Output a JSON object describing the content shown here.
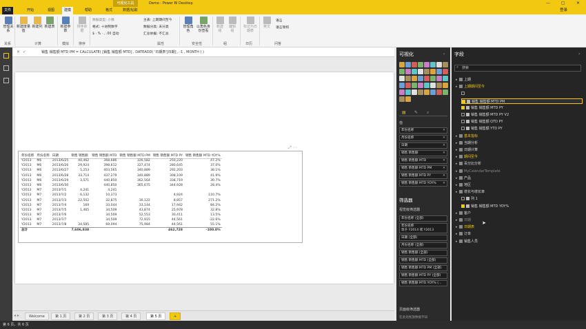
{
  "window": {
    "context_tab": "可视化工具",
    "title": "Demo - Power BI Desktop"
  },
  "tabs": [
    "文件",
    "开始",
    "视图",
    "建模",
    "帮助",
    "格式",
    "数据/钻取"
  ],
  "login": "登录",
  "ribbon": {
    "buttons": [
      "管理关系",
      "新建度量值",
      "新建列",
      "新建表",
      "新建参数",
      "排序依据",
      "管理角色",
      "以角色身份查看",
      "新建组",
      "编辑组",
      "标记为日期表",
      "英文"
    ],
    "groups": [
      "关系",
      "计算",
      "模拟",
      "排序",
      "属性",
      "安全性",
      "组",
      "日历",
      "问答"
    ],
    "fmt": [
      "数据类型: 小数",
      "格式: 十进制数字",
      "$ · % · ,  .00  自动"
    ],
    "props": [
      "主表: 上期期间至今",
      "数据分类: 未分类",
      "汇总依据: 不汇总"
    ],
    "lang": [
      "语言",
      "语言架构"
    ]
  },
  "formula": {
    "text": "销售 销售额 MTD PM = CALCULATE( [销售 销售额 MTD] , DATEADD( '日期表'[日期] , -1 , MONTH ) )"
  },
  "table": {
    "headers": [
      "年份名称",
      "月份名称",
      "日期",
      "销售 销售额",
      "销售 销售额 MTD",
      "销售 销售额 MTD PM",
      "销售 销售额 MTD PY",
      "销售 销售额 MTD YOY%"
    ],
    "rows": [
      [
        "Y2013",
        "M6",
        "2013/6/25",
        "40,462",
        "368,686",
        "326,582",
        "250,220",
        "47.2%"
      ],
      [
        "Y2013",
        "M6",
        "2013/6/26",
        "29,924",
        "398,612",
        "327,474",
        "280,645",
        "37.0%"
      ],
      [
        "Y2013",
        "M6",
        "2013/6/27",
        "5,253",
        "403,565",
        "340,889",
        "292,203",
        "38.1%"
      ],
      [
        "Y2013",
        "M6",
        "2013/6/28",
        "33,714",
        "437,279",
        "340,889",
        "308,109",
        "41.9%"
      ],
      [
        "Y2013",
        "M6",
        "2013/6/29",
        "3,571",
        "440,850",
        "362,564",
        "338,719",
        "30.7%"
      ],
      [
        "Y2013",
        "M6",
        "2013/6/30",
        "",
        "440,850",
        "365,675",
        "344,928",
        "28.4%"
      ],
      [
        "Y2013",
        "M7",
        "2013/7/1",
        "4,241",
        "4,241",
        "",
        "",
        ""
      ],
      [
        "Y2013",
        "M7",
        "2013/7/2",
        "6,132",
        "10,373",
        "",
        "4,924",
        "110.7%"
      ],
      [
        "Y2013",
        "M7",
        "2013/7/3",
        "22,502",
        "32,875",
        "16,122",
        "8,857",
        "271.2%"
      ],
      [
        "Y2013",
        "M7",
        "2013/7/4",
        "169",
        "33,044",
        "33,144",
        "17,942",
        "84.2%"
      ],
      [
        "Y2013",
        "M7",
        "2013/7/5",
        "1,465",
        "34,509",
        "43,874",
        "25,978",
        "32.8%"
      ],
      [
        "Y2013",
        "M7",
        "2013/7/6",
        "",
        "34,509",
        "52,553",
        "30,411",
        "13.5%"
      ],
      [
        "Y2013",
        "M7",
        "2013/7/7",
        "",
        "34,509",
        "72,915",
        "44,561",
        "-22.6%"
      ],
      [
        "Y2013",
        "M7",
        "2013/7/8",
        "34,585",
        "69,094",
        "75,984",
        "44,561",
        "55.1%"
      ]
    ],
    "total": [
      "总计",
      "",
      "",
      "7,606,838",
      "",
      "",
      "462,728",
      "-100.0%"
    ]
  },
  "pages": [
    "Welcome",
    "第 1 页",
    "第 2 页",
    "第 3 页",
    "第 4 页",
    "第 5 页",
    "+"
  ],
  "status": "第 6 页，共 6 页",
  "viz": {
    "title": "可视化",
    "values_label": "值",
    "wells": [
      "年份名称",
      "月份名称",
      "日期",
      "销售 销售额",
      "销售 销售额 MTD",
      "销售 销售额 MTD PM",
      "销售 销售额 MTD PY",
      "销售 销售额 MTD YOY%"
    ],
    "filters_title": "筛选器",
    "visual_filters_label": "视觉级筛选器",
    "filters": [
      "年份名称 (全部)",
      "年份名称\n等于 Y2014 或 Y2013",
      "日期 (全部)",
      "月份名称 (全部)",
      "销售 销售额 (全部)",
      "销售 销售额 MTD (全部)",
      "销售 销售额 MTD PM (全部)",
      "销售 销售额 MTD PY (全部)",
      "销售 销售额 MTD YOY% (..."
    ],
    "page_filters_label": "页面级筛选器",
    "drop_text": "在此处拖放数据字段"
  },
  "fields": {
    "title": "字段",
    "search_placeholder": "搜索",
    "items": [
      {
        "text": "上期",
        "type": "folder"
      },
      {
        "text": "上期期间至今",
        "type": "folder-y"
      },
      {
        "text": "",
        "type": "check"
      },
      {
        "text": "销售 销售额 MTD PM",
        "type": "check-on",
        "sel": true
      },
      {
        "text": "销售 销售额 MTD PY",
        "type": "check-on"
      },
      {
        "text": "销售 销售额 MTD PY V2",
        "type": "check"
      },
      {
        "text": "销售 销售额 QTD PY",
        "type": "check"
      },
      {
        "text": "销售 销售额 YTD PY",
        "type": "check"
      },
      {
        "text": "基本指标",
        "type": "folder-y"
      },
      {
        "text": "当期分析",
        "type": "folder"
      },
      {
        "text": "日期计算",
        "type": "folder"
      },
      {
        "text": "期间至今",
        "type": "folder-y"
      },
      {
        "text": "百分比分析",
        "type": "folder"
      },
      {
        "text": "MyCalendarTemplate",
        "type": "folder-dim"
      },
      {
        "text": "产品",
        "type": "folder"
      },
      {
        "text": "地区",
        "type": "folder"
      },
      {
        "text": "增长与增长率",
        "type": "folder"
      },
      {
        "text": "列 1",
        "type": "check"
      },
      {
        "text": "销售 销售额 MTD YOY%",
        "type": "check-on"
      },
      {
        "text": "客户",
        "type": "folder"
      },
      {
        "text": "日期",
        "type": "folder-dim"
      },
      {
        "text": "日期表",
        "type": "folder-y"
      },
      {
        "text": "订单",
        "type": "folder"
      },
      {
        "text": "销售人员",
        "type": "folder"
      }
    ]
  },
  "colors": {
    "accent": "#f2c811",
    "pane_dark": "#2b2b2b"
  }
}
